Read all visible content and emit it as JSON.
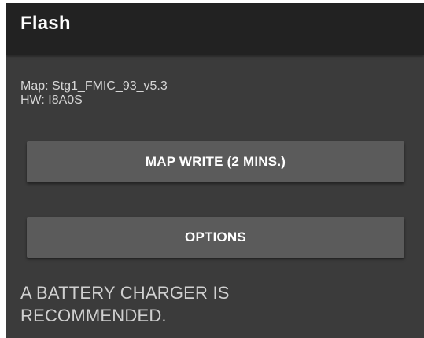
{
  "header": {
    "title": "Flash"
  },
  "info": {
    "map_line": "Map: Stg1_FMIC_93_v5.3",
    "hw_line": "HW: I8A0S"
  },
  "buttons": {
    "map_write_label": "MAP WRITE (2 MINS.)",
    "options_label": "OPTIONS"
  },
  "notice": {
    "line1": "A BATTERY CHARGER IS",
    "line2": "RECOMMENDED."
  },
  "colors": {
    "title_bar": "#222222",
    "background": "#3b3b3b",
    "button": "#5b5b5b",
    "text_primary": "#ffffff",
    "text_secondary": "#d6d6d6"
  }
}
